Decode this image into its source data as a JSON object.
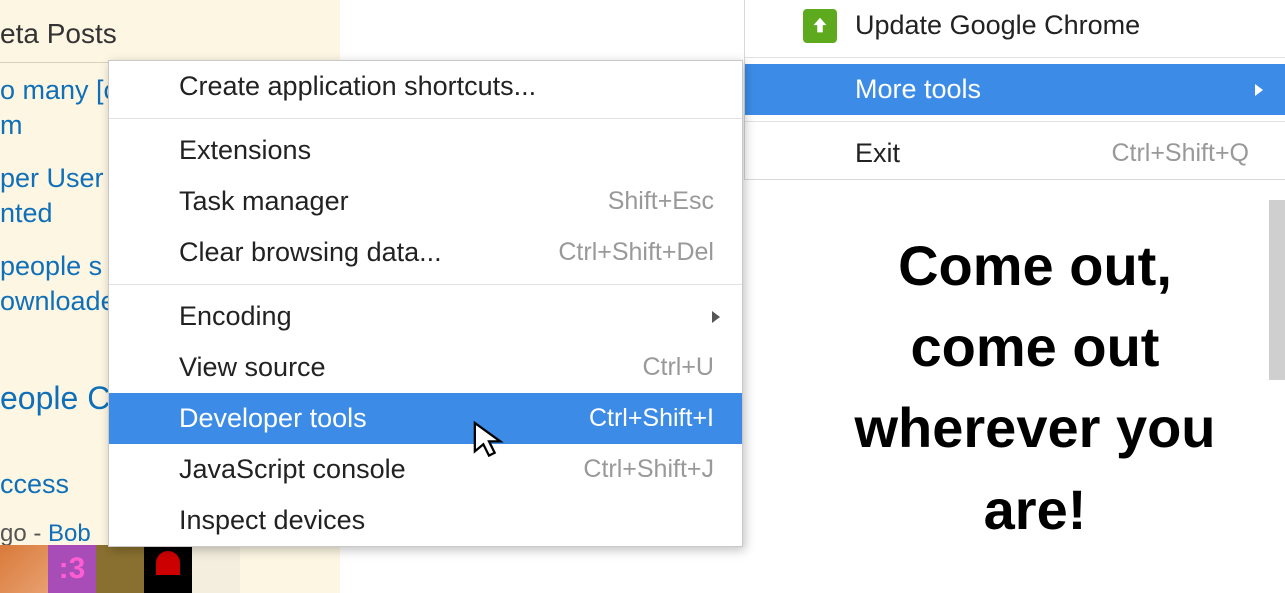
{
  "sidebar": {
    "heading": "eta Posts",
    "links": [
      "o many [c\nm",
      "per User\nnted",
      "people s\nownloader"
    ],
    "section2": "eople C",
    "recent_label": "ccess",
    "recent_time": "go - ",
    "recent_user": "Bob"
  },
  "mainmenu": {
    "update": "Update Google Chrome",
    "more_tools": "More tools",
    "exit": "Exit",
    "exit_shortcut": "Ctrl+Shift+Q"
  },
  "submenu": {
    "create_shortcuts": "Create application shortcuts...",
    "extensions": "Extensions",
    "task_manager": "Task manager",
    "task_manager_sc": "Shift+Esc",
    "clear_data": "Clear browsing data...",
    "clear_data_sc": "Ctrl+Shift+Del",
    "encoding": "Encoding",
    "view_source": "View source",
    "view_source_sc": "Ctrl+U",
    "dev_tools": "Developer tools",
    "dev_tools_sc": "Ctrl+Shift+I",
    "js_console": "JavaScript console",
    "js_console_sc": "Ctrl+Shift+J",
    "inspect_devices": "Inspect devices"
  },
  "annotation": "Come out, come out wherever you are!",
  "avatar2_text": ":3"
}
